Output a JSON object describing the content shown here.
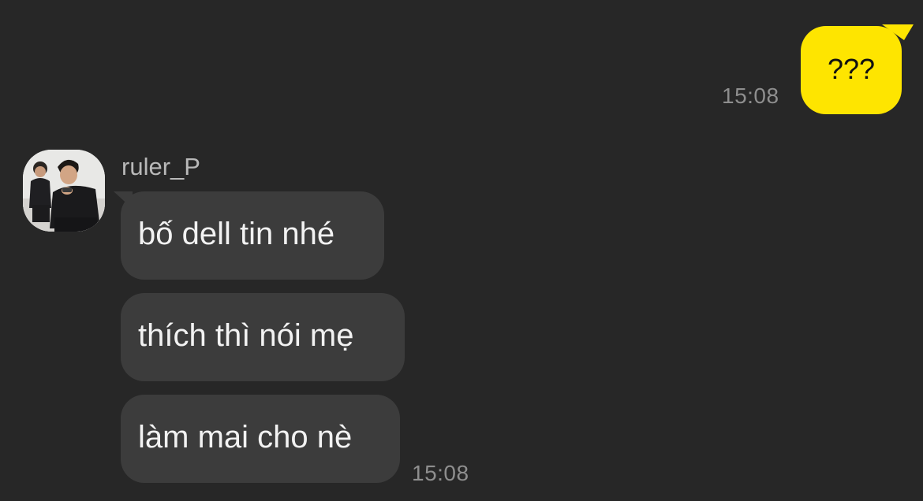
{
  "outgoing": {
    "text": "???",
    "time": "15:08"
  },
  "incoming": {
    "sender": "ruler_P",
    "messages": [
      {
        "text": "bố dell tin nhé"
      },
      {
        "text": "thích thì nói mẹ"
      },
      {
        "text": "làm mai cho nè"
      }
    ],
    "time": "15:08"
  },
  "colors": {
    "background": "#272727",
    "outgoing_bubble": "#FEE500",
    "incoming_bubble": "#3c3c3c",
    "timestamp": "#8e8e8e",
    "sender_name": "#b9b9b9"
  },
  "icons": {
    "avatar": "profile-photo-two-people"
  }
}
